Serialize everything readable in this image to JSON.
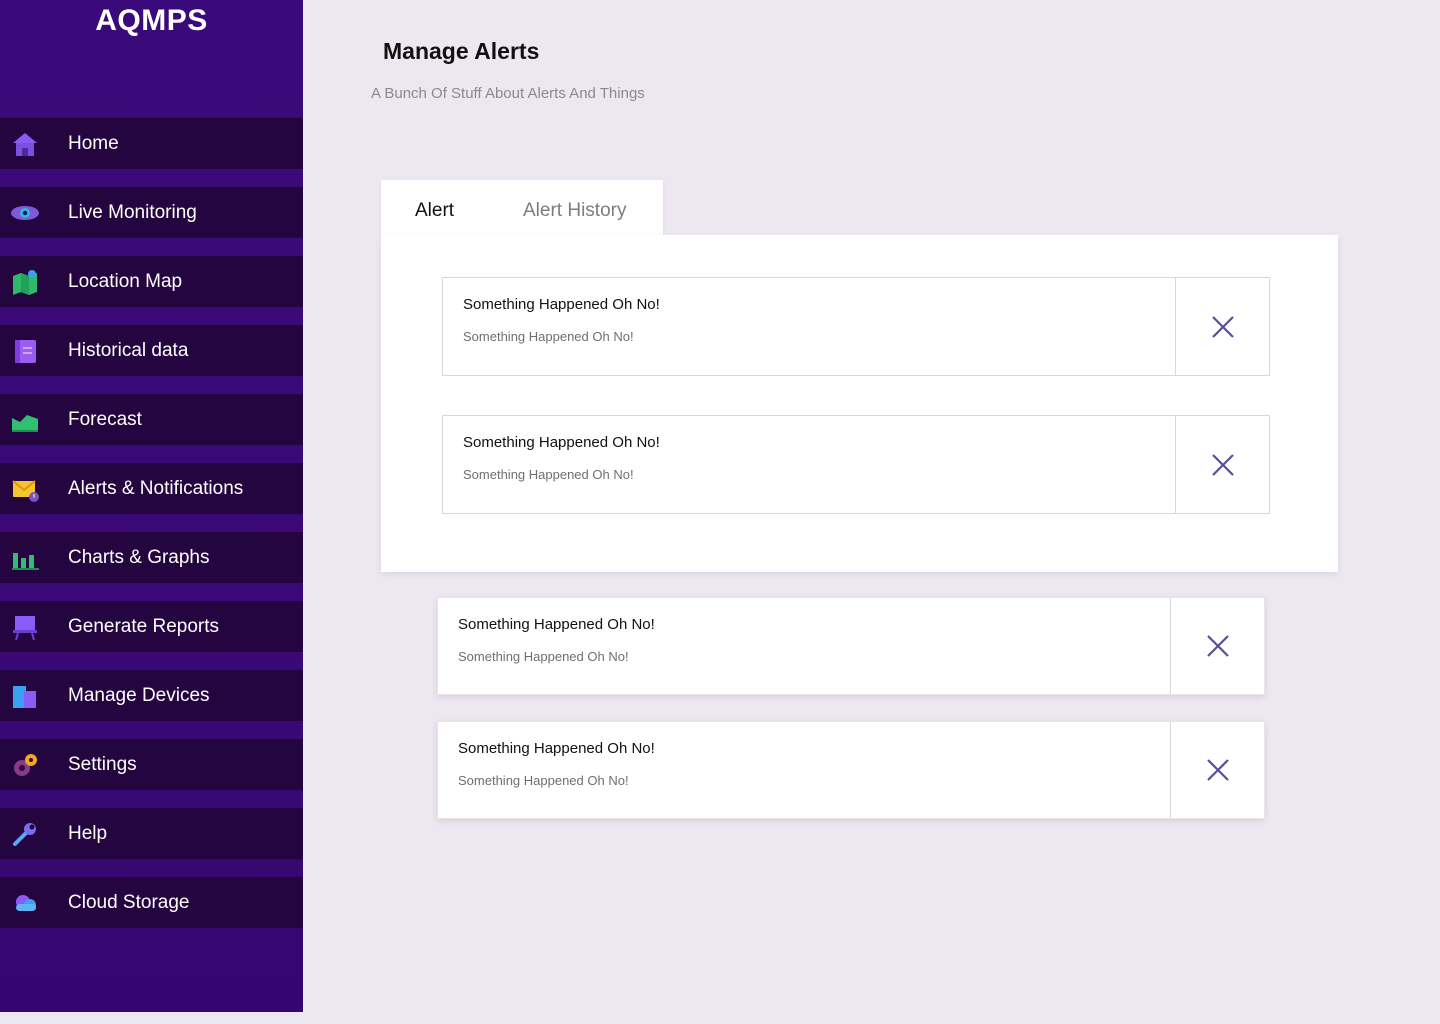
{
  "app": {
    "brand": "AQMPS"
  },
  "sidebar": {
    "items": [
      {
        "label": "Home",
        "icon": "home-icon"
      },
      {
        "label": "Live Monitoring",
        "icon": "eye-icon"
      },
      {
        "label": "Location Map",
        "icon": "map-icon"
      },
      {
        "label": "Historical data",
        "icon": "notebook-icon"
      },
      {
        "label": "Forecast",
        "icon": "area-chart-icon"
      },
      {
        "label": "Alerts & Notifications",
        "icon": "mail-alert-icon"
      },
      {
        "label": "Charts & Graphs",
        "icon": "bar-chart-icon"
      },
      {
        "label": "Generate Reports",
        "icon": "easel-icon"
      },
      {
        "label": "Manage Devices",
        "icon": "devices-icon"
      },
      {
        "label": "Settings",
        "icon": "gear-icon"
      },
      {
        "label": "Help",
        "icon": "wrench-icon"
      },
      {
        "label": "Cloud Storage",
        "icon": "cloud-icon"
      }
    ]
  },
  "header": {
    "title": "Manage Alerts",
    "subtitle": "A Bunch Of Stuff About Alerts And Things"
  },
  "tabs": [
    {
      "label": "Alert",
      "active": true
    },
    {
      "label": "Alert History",
      "active": false
    }
  ],
  "alerts": [
    {
      "title": "Something Happened Oh No!",
      "message": "Something Happened Oh No!"
    },
    {
      "title": "Something Happened Oh No!",
      "message": "Something Happened Oh No!"
    },
    {
      "title": "Something Happened Oh No!",
      "message": "Something Happened Oh No!"
    },
    {
      "title": "Something Happened Oh No!",
      "message": "Something Happened Oh No!"
    }
  ],
  "colors": {
    "sidebar_bg": "#3b0a7a",
    "nav_item_bg": "#25053f",
    "page_bg": "#ede7f2",
    "close_icon": "#5b4a9e"
  }
}
